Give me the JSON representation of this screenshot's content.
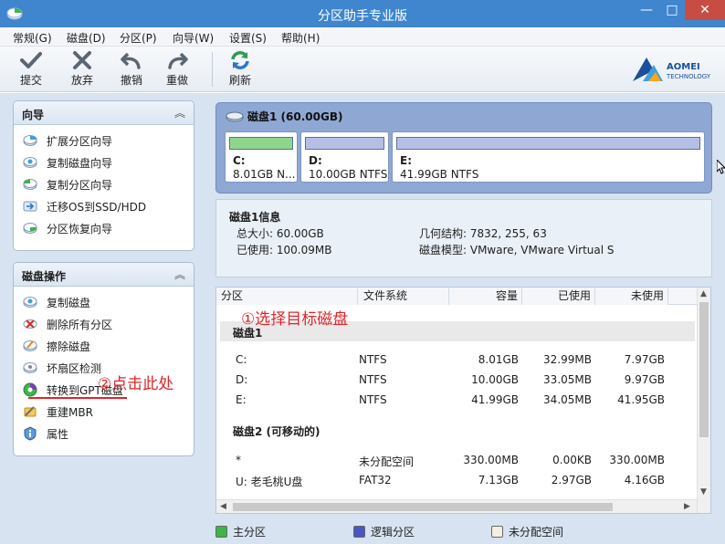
{
  "window": {
    "title": "分区助手专业版",
    "controls": {
      "minimize": "—",
      "maximize": "□",
      "close": "✕"
    }
  },
  "menu": [
    "常规(G)",
    "磁盘(D)",
    "分区(P)",
    "向导(W)",
    "设置(S)",
    "帮助(H)"
  ],
  "toolbar": {
    "buttons": [
      {
        "label": "提交",
        "icon": "check-icon"
      },
      {
        "label": "放弃",
        "icon": "x-icon"
      },
      {
        "label": "撤销",
        "icon": "undo-icon"
      },
      {
        "label": "重做",
        "icon": "redo-icon"
      },
      {
        "label": "刷新",
        "icon": "refresh-icon"
      }
    ],
    "logo": {
      "name": "AOMEI",
      "sub": "TECHNOLOGY"
    }
  },
  "sidebar": {
    "wizard": {
      "title": "向导",
      "items": [
        "扩展分区向导",
        "复制磁盘向导",
        "复制分区向导",
        "迁移OS到SSD/HDD",
        "分区恢复向导"
      ]
    },
    "disk_ops": {
      "title": "磁盘操作",
      "items": [
        "复制磁盘",
        "删除所有分区",
        "擦除磁盘",
        "坏扇区检测",
        "转换到GPT磁盘",
        "重建MBR",
        "属性"
      ]
    }
  },
  "disk_map": {
    "title": "磁盘1 (60.00GB)",
    "partitions": [
      {
        "name": "C:",
        "info": "8.01GB N...",
        "color": "#8fd68d"
      },
      {
        "name": "D:",
        "info": "10.00GB NTFS",
        "color": "#b5bfe6"
      },
      {
        "name": "E:",
        "info": "41.99GB NTFS",
        "color": "#b5bfe6"
      }
    ]
  },
  "disk_info": {
    "title": "磁盘1信息",
    "total_size": "总大小: 60.00GB",
    "used": "已使用: 100.09MB",
    "geometry": "几何结构: 7832, 255, 63",
    "model": "磁盘模型: VMware, VMware Virtual S"
  },
  "table": {
    "headers": [
      "分区",
      "文件系统",
      "容量",
      "已使用",
      "未使用"
    ],
    "groups": [
      {
        "label": "磁盘1",
        "rows": [
          [
            "C:",
            "NTFS",
            "8.01GB",
            "32.99MB",
            "7.97GB"
          ],
          [
            "D:",
            "NTFS",
            "10.00GB",
            "33.05MB",
            "9.97GB"
          ],
          [
            "E:",
            "NTFS",
            "41.99GB",
            "34.05MB",
            "41.95GB"
          ]
        ]
      },
      {
        "label": "磁盘2 (可移动的)",
        "rows": [
          [
            "*",
            "未分配空间",
            "330.00MB",
            "0.00KB",
            "330.00MB"
          ],
          [
            "U: 老毛桃U盘",
            "FAT32",
            "7.13GB",
            "2.97GB",
            "4.16GB"
          ]
        ]
      }
    ]
  },
  "legend": [
    {
      "label": "主分区",
      "color": "#3db54a"
    },
    {
      "label": "逻辑分区",
      "color": "#4b56c5"
    },
    {
      "label": "未分配空间",
      "color": "#f4efe4"
    }
  ],
  "annotations": {
    "step1": "①选择目标磁盘",
    "step2": "②点击此处"
  },
  "colors": {
    "titlebar": "#3f86cf",
    "close": "#c74d44",
    "accent_red": "#e0242a",
    "disk_card": "#8fa8d3"
  }
}
